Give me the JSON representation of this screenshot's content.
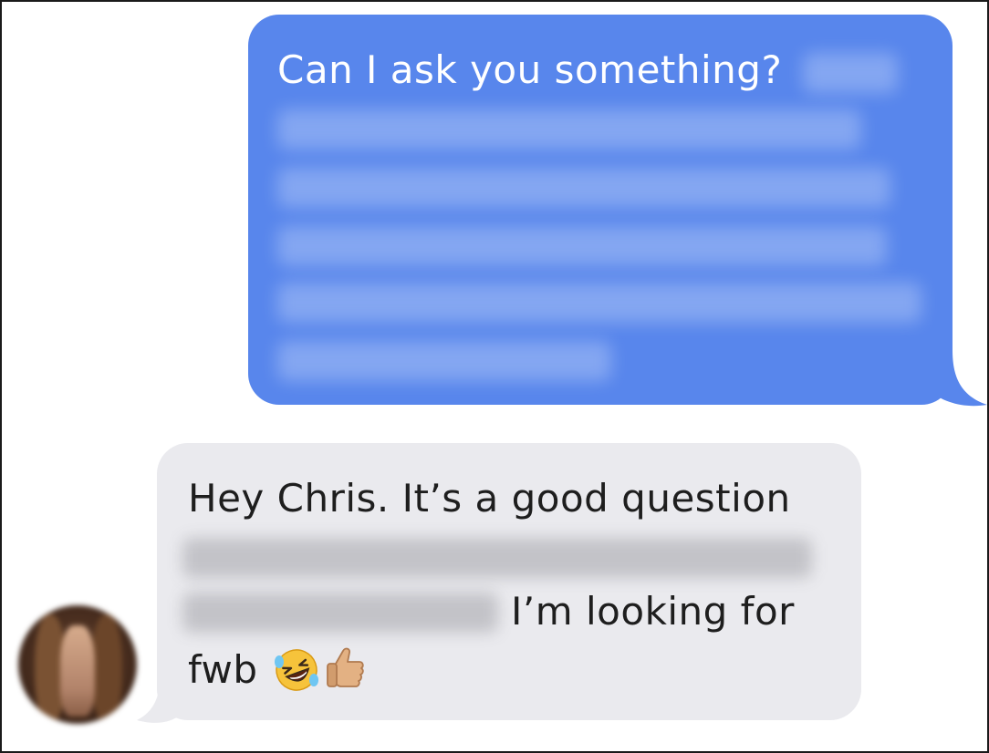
{
  "conversation": {
    "sent_message": {
      "visible_text": "Can I ask you something?",
      "bubble_color": "#5886ec",
      "text_color": "#ffffff",
      "blurred": true
    },
    "received_message": {
      "line_1": "Hey Chris. It’s a good question",
      "line_3_visible": "I’m looking for",
      "line_4": "fwb",
      "emojis": [
        "rolling-on-floor-laughing-emoji",
        "thumbs-up-emoji"
      ],
      "bubble_color": "#eaeaee",
      "text_color": "#1e1e1e",
      "blurred": true
    },
    "sender_avatar": {
      "icon": "avatar",
      "blurred": true
    }
  }
}
